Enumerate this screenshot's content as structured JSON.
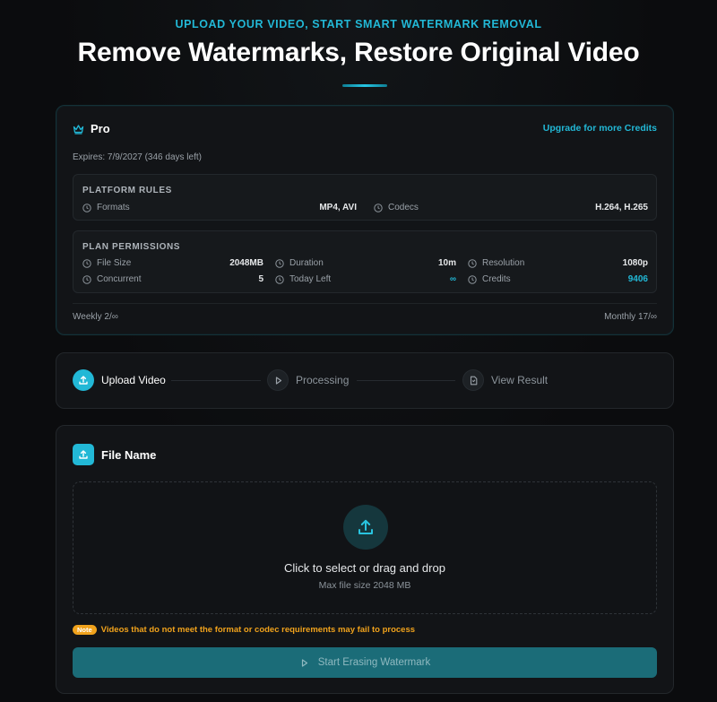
{
  "hero": {
    "eyebrow": "UPLOAD YOUR VIDEO, START SMART WATERMARK REMOVAL",
    "title": "Remove Watermarks, Restore Original Video"
  },
  "plan": {
    "tier": "Pro",
    "tier_icon": "crown-icon",
    "upgrade_label": "Upgrade for more Credits",
    "expires": "Expires: 7/9/2027 (346 days left)",
    "platform_rules": {
      "title": "PLATFORM RULES",
      "items": [
        {
          "label": "Formats",
          "value": "MP4, AVI",
          "icon": "clock-icon"
        },
        {
          "label": "Codecs",
          "value": "H.264, H.265",
          "icon": "clock-icon"
        }
      ]
    },
    "permissions": {
      "title": "PLAN PERMISSIONS",
      "items": [
        {
          "label": "File Size",
          "value": "2048MB",
          "icon": "clock-icon"
        },
        {
          "label": "Duration",
          "value": "10m",
          "icon": "clock-icon"
        },
        {
          "label": "Resolution",
          "value": "1080p",
          "icon": "clock-icon"
        },
        {
          "label": "Concurrent",
          "value": "5",
          "icon": "clock-icon"
        },
        {
          "label": "Today Left",
          "value": "∞",
          "icon": "clock-icon"
        },
        {
          "label": "Credits",
          "value": "9406",
          "icon": "clock-icon"
        }
      ]
    },
    "weekly": "Weekly 2/∞",
    "monthly": "Monthly 17/∞"
  },
  "steps": [
    {
      "label": "Upload Video",
      "icon": "upload-icon",
      "state": "active"
    },
    {
      "label": "Processing",
      "icon": "play-icon",
      "state": "idle"
    },
    {
      "label": "View Result",
      "icon": "file-icon",
      "state": "idle"
    }
  ],
  "upload": {
    "title": "File Name",
    "drop_main": "Click to select or drag and drop",
    "drop_sub": "Max file size 2048 MB",
    "note_badge": "Note",
    "note_text": "Videos that do not meet the format or codec requirements may fail to process",
    "start_label": "Start Erasing Watermark"
  },
  "colors": {
    "accent": "#22b8d6",
    "warning": "#f0a21c",
    "background": "#0b0c0e",
    "card": "#121417"
  }
}
